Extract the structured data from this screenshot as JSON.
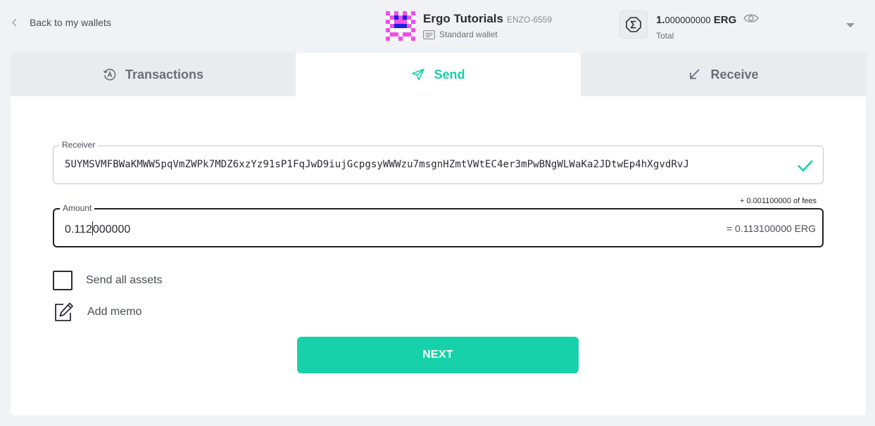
{
  "header": {
    "back_label": "Back to my wallets",
    "wallet": {
      "name": "Ergo Tutorials",
      "plate": "ENZO-6559",
      "type": "Standard wallet"
    },
    "balance": {
      "integer": "1.",
      "decimals": "000000000",
      "unit": "ERG",
      "caption": "Total"
    }
  },
  "tabs": [
    {
      "label": "Transactions",
      "icon": "transactions-icon",
      "active": false
    },
    {
      "label": "Send",
      "icon": "send-icon",
      "active": true
    },
    {
      "label": "Receive",
      "icon": "receive-icon",
      "active": false
    }
  ],
  "form": {
    "receiver": {
      "label": "Receiver",
      "value": "5UYMSVMFBWaKMWW5pqVmZWPk7MDZ6xzYz91sP1FqJwD9iujGcpgsyWWWzu7msgnHZmtVWtEC4er3mPwBNgWLWaKa2JDtwEp4hXgvdRvJ"
    },
    "amount": {
      "label": "Amount",
      "value_before_caret": "0.112",
      "value_after_caret": "000000",
      "total": "= 0.113100000 ERG",
      "fees": "+ 0.001100000 of fees"
    },
    "send_all_label": "Send all assets",
    "memo_label": "Add memo",
    "next_label": "NEXT"
  },
  "colors": {
    "accent": "#17d1aa",
    "background": "#f0f2f5",
    "tab_inactive": "#e9ecef",
    "text": "#2b2b33"
  }
}
